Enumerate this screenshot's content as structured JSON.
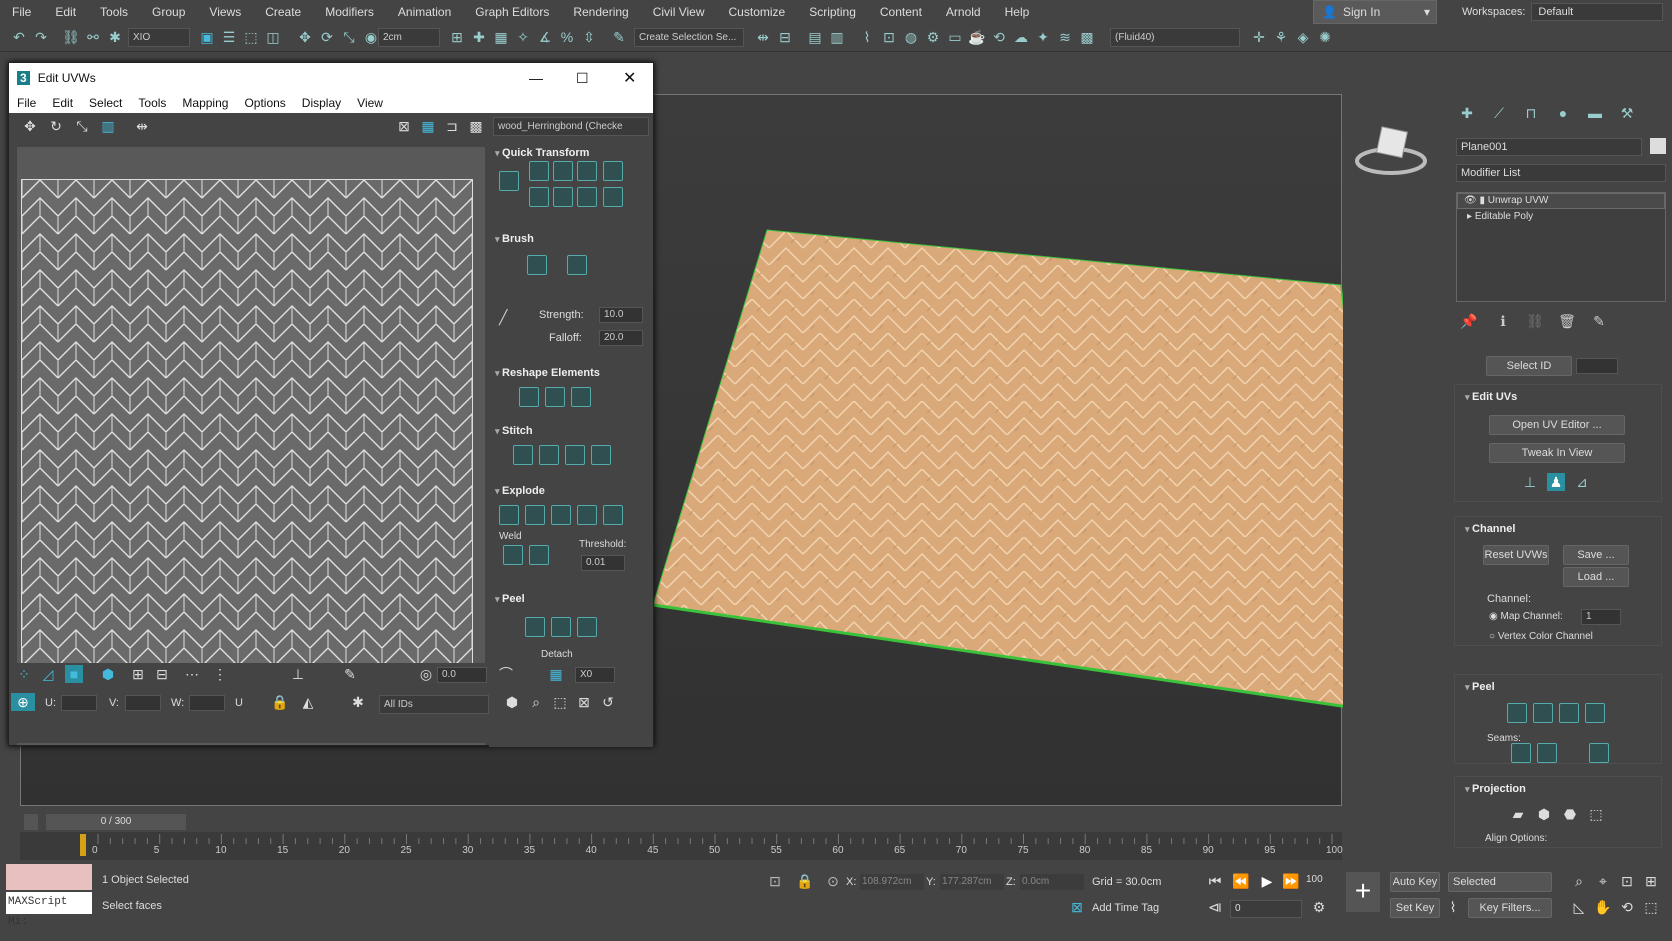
{
  "menubar": {
    "items": [
      "File",
      "Edit",
      "Tools",
      "Group",
      "Views",
      "Create",
      "Modifiers",
      "Animation",
      "Graph Editors",
      "Rendering",
      "Civil View",
      "Customize",
      "Scripting",
      "Content",
      "Arnold",
      "Help"
    ],
    "sign_in": "Sign In",
    "workspaces_label": "Workspaces:",
    "workspace_value": "Default"
  },
  "toolbar": {
    "xform_dropdown": "XIO",
    "unit_dropdown": "2cm",
    "selection_set": "Create Selection Se...",
    "fluid_dropdown": "(Fluid40)"
  },
  "uv_editor": {
    "title": "Edit UVWs",
    "menu": [
      "File",
      "Edit",
      "Select",
      "Tools",
      "Mapping",
      "Options",
      "Display",
      "View"
    ],
    "texture_dropdown": "wood_Herringbond (Checke",
    "sections": {
      "quick_transform": "Quick Transform",
      "brush": "Brush",
      "reshape": "Reshape Elements",
      "stitch": "Stitch",
      "explode": "Explode",
      "peel": "Peel"
    },
    "brush_strength_label": "Strength:",
    "brush_strength": "10.0",
    "brush_falloff_label": "Falloff:",
    "brush_falloff": "20.0",
    "weld_label": "Weld",
    "threshold_label": "Threshold:",
    "threshold": "0.01",
    "detach": "Detach",
    "bottom": {
      "u_label": "U:",
      "v_label": "V:",
      "w_label": "W:",
      "u_axis": "U",
      "spinner_val": "0.0",
      "x0": "X0",
      "ids": "All IDs"
    }
  },
  "command_panel": {
    "object_name": "Plane001",
    "modifier_list": "Modifier List",
    "stack": [
      "Unwrap UVW",
      "Editable Poly"
    ],
    "select_id": "Select ID",
    "edit_uvs": {
      "header": "Edit UVs",
      "open_editor": "Open UV Editor ...",
      "tweak": "Tweak In View"
    },
    "channel": {
      "header": "Channel",
      "reset": "Reset UVWs",
      "save": "Save ...",
      "load": "Load ...",
      "label": "Channel:",
      "map_channel": "Map Channel:",
      "map_value": "1",
      "vertex_color": "Vertex Color Channel"
    },
    "peel": {
      "header": "Peel",
      "seams": "Seams:"
    },
    "projection": {
      "header": "Projection",
      "align": "Align Options:"
    }
  },
  "timeline": {
    "frame": "0 / 300",
    "ticks": [
      "0",
      "5",
      "10",
      "15",
      "20",
      "25",
      "30",
      "35",
      "40",
      "45",
      "50",
      "55",
      "60",
      "65",
      "70",
      "75",
      "80",
      "85",
      "90",
      "95",
      "100"
    ],
    "end_frame": "100"
  },
  "status": {
    "maxscript": "MAXScript Mi:",
    "selected": "1 Object Selected",
    "prompt": "Select faces",
    "x_label": "X:",
    "x": "108.972cm",
    "y_label": "Y:",
    "y": "177.287cm",
    "z_label": "Z:",
    "z": "0.0cm",
    "grid": "Grid = 30.0cm",
    "add_time_tag": "Add Time Tag",
    "auto_key": "Auto Key",
    "selected_dd": "Selected",
    "set_key": "Set Key",
    "key_filters": "Key Filters...",
    "frame_input": "0",
    "frame_end": "100"
  },
  "colors": {
    "wood": "#d9a979",
    "edge_green": "#3ac23a",
    "accent": "#2fa7b6"
  }
}
